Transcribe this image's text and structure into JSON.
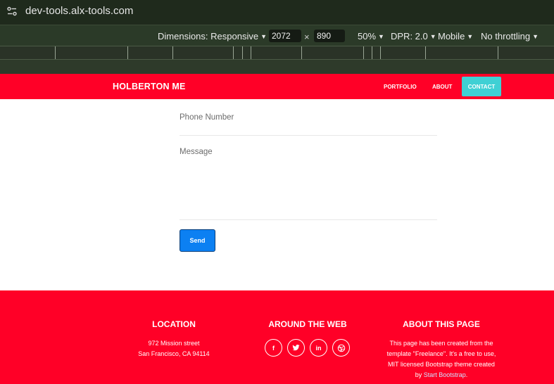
{
  "browser": {
    "url": "dev-tools.alx-tools.com"
  },
  "devtools": {
    "dimensions_label": "Dimensions: Responsive",
    "width": "2072",
    "times": "×",
    "height": "890",
    "zoom": "50%",
    "dpr": "DPR: 2.0",
    "device_type": "Mobile",
    "throttling": "No throttling"
  },
  "nav": {
    "brand": "HOLBERTON ME",
    "links": [
      "PORTFOLIO",
      "ABOUT",
      "CONTACT"
    ],
    "contact_color": "#3fd0d4",
    "bg_color": "#ff0027"
  },
  "form": {
    "phone_placeholder": "Phone Number",
    "message_placeholder": "Message",
    "send_label": "Send",
    "button_color": "#0c80f2"
  },
  "footer": {
    "location_title": "LOCATION",
    "location_line1": "972 Mission street",
    "location_line2": "San Francisco, CA 94114",
    "web_title": "AROUND THE WEB",
    "social_icons": [
      "facebook-icon",
      "twitter-icon",
      "linkedin-icon",
      "dribbble-icon"
    ],
    "about_title": "ABOUT THIS PAGE",
    "about_line1": "This page has been created from the",
    "about_line2": "template \"Freelance\". It's a free to use,",
    "about_line3": "MIT licensed Bootstrap theme created",
    "about_line4_prefix": "by",
    "about_link": "Start Bootstrap",
    "about_line4_suffix": "."
  }
}
